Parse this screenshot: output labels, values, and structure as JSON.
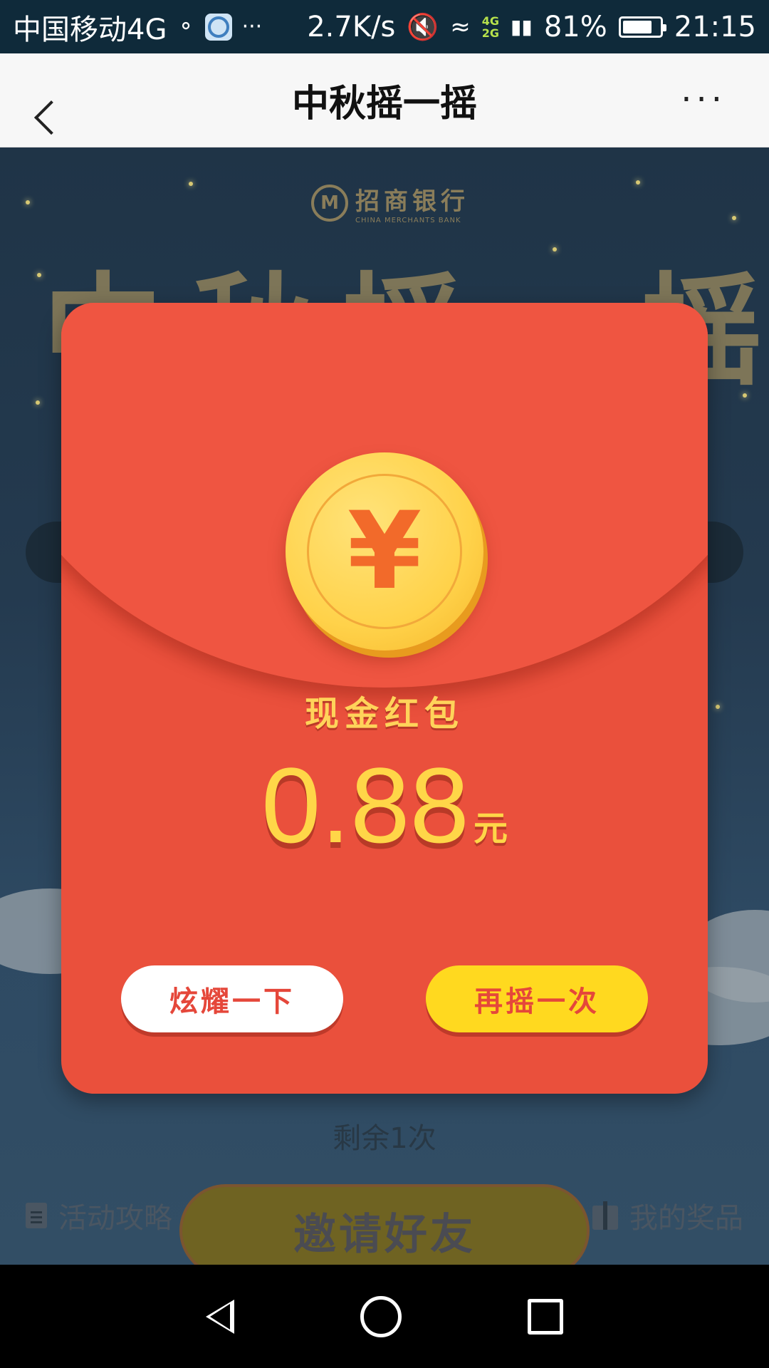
{
  "status_bar": {
    "carrier": "中国移动4G",
    "speed": "2.7K/s",
    "network_top": "4G",
    "network_bottom": "2G",
    "battery": "81%",
    "battery_level": 0.81,
    "time": "21:15"
  },
  "header": {
    "title": "中秋摇一摇",
    "more": "···"
  },
  "background": {
    "bank_name_cn": "招商银行",
    "bank_name_en": "CHINA MERCHANTS BANK",
    "big_title": "中秋摇一摇",
    "remaining": "剩余1次",
    "guide_link": "活动攻略",
    "prizes_link": "我的奖品",
    "invite_button": "邀请好友"
  },
  "modal": {
    "coin_symbol": "¥",
    "label": "现金红包",
    "amount": "0.88",
    "unit": "元",
    "show_off_button": "炫耀一下",
    "shake_again_button": "再摇一次"
  },
  "colors": {
    "envelope": "#ea503c",
    "coin": "#ffd24a",
    "accent_yellow": "#ffd91f"
  }
}
